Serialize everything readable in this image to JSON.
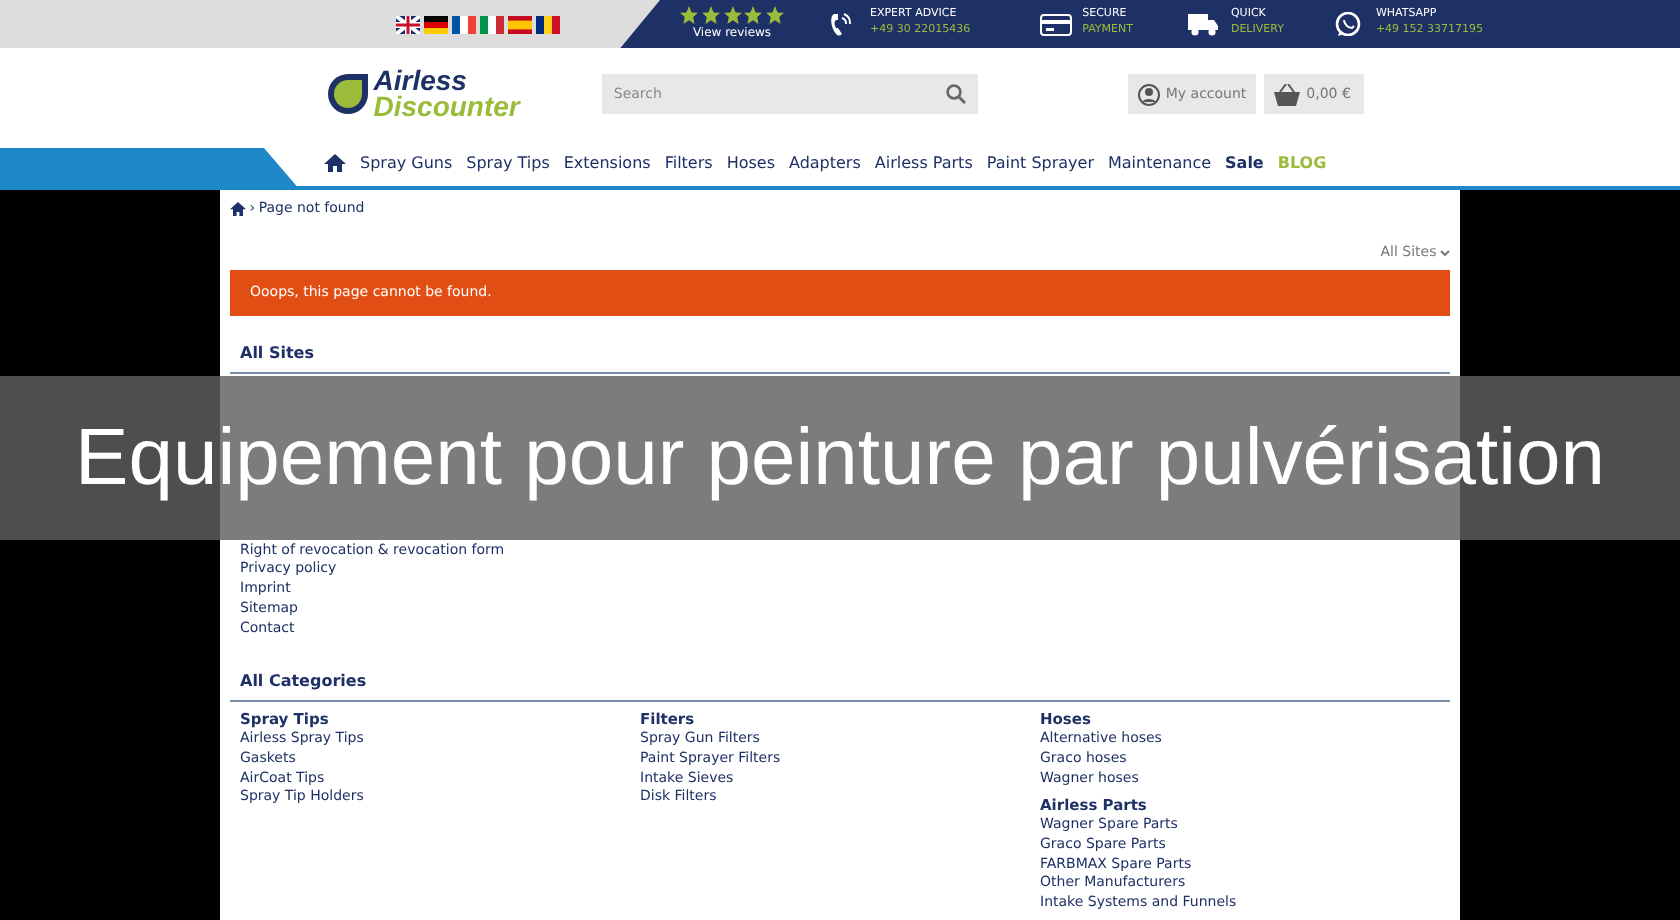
{
  "top_bar": {
    "rating": {
      "stars": 5,
      "label": "View reviews"
    },
    "features": [
      {
        "kind": "phone",
        "title": "EXPERT ADVICE",
        "detail": "+49 30 22015436"
      },
      {
        "kind": "card",
        "title": "SECURE",
        "detail": "PAYMENT"
      },
      {
        "kind": "truck",
        "title": "QUICK",
        "detail": "DELIVERY"
      },
      {
        "kind": "chat",
        "title": "WHATSAPP",
        "detail": "+49 152 33717195"
      }
    ]
  },
  "header": {
    "logo": {
      "line_1": "Airless",
      "line_2": "Discounter"
    },
    "search": {
      "placeholder": "Search"
    },
    "account": "My account",
    "cart": "0,00 €"
  },
  "nav": [
    {
      "kind": "home"
    },
    {
      "kind": "link",
      "label": "Spray Guns"
    },
    {
      "kind": "link",
      "label": "Spray Tips"
    },
    {
      "kind": "link",
      "label": "Extensions"
    },
    {
      "kind": "link",
      "label": "Filters"
    },
    {
      "kind": "link",
      "label": "Hoses"
    },
    {
      "kind": "link",
      "label": "Adapters"
    },
    {
      "kind": "link",
      "label": "Airless Parts"
    },
    {
      "kind": "link",
      "label": "Paint Sprayer"
    },
    {
      "kind": "link",
      "label": "Maintenance"
    },
    {
      "kind": "sale",
      "label": "Sale"
    },
    {
      "kind": "blog",
      "label": "BLOG"
    }
  ],
  "breadcrumb": {
    "separator": "›",
    "current": "Page not found"
  },
  "site_select": "All Sites",
  "alert": "Ooops, this page cannot be found.",
  "all_sites": {
    "title": "All Sites",
    "columns": [
      {
        "links": [
          "Right of revocation & revocation form",
          "Privacy policy",
          "Imprint",
          "Sitemap",
          "Contact"
        ]
      }
    ]
  },
  "all_categories": {
    "title": "All Categories",
    "columns": [
      [
        {
          "title": "Spray Tips",
          "links": [
            "Airless Spray Tips",
            "Gaskets",
            "AirCoat Tips",
            "Spray Tip Holders"
          ]
        }
      ],
      [
        {
          "title": "Filters",
          "links": [
            "Spray Gun Filters",
            "Paint Sprayer Filters",
            "Intake Sieves",
            "Disk Filters"
          ]
        }
      ],
      [
        {
          "title": "Hoses",
          "links": [
            "Alternative hoses",
            "Graco hoses",
            "Wagner hoses"
          ]
        },
        {
          "title": "Airless Parts",
          "links": [
            "Wagner Spare Parts",
            "Graco Spare Parts",
            "FARBMAX Spare Parts",
            "Other Manufacturers",
            "Intake Systems and Funnels"
          ]
        }
      ]
    ]
  },
  "banner": "Equipement pour peinture par pulvérisation"
}
